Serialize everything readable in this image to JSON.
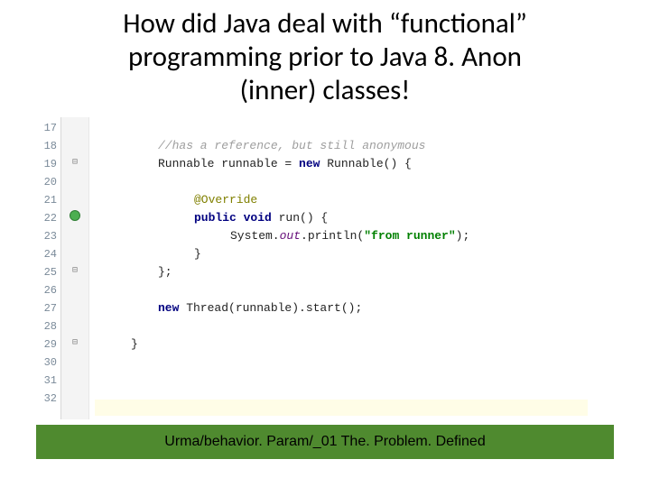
{
  "title_lines": {
    "l1": "How did Java deal with “functional”",
    "l2": "programming prior to Java 8. Anon",
    "l3": "(inner) classes!"
  },
  "line_numbers": [
    "17",
    "18",
    "19",
    "20",
    "21",
    "22",
    "23",
    "24",
    "25",
    "26",
    "27",
    "28",
    "29",
    "30",
    "31",
    "32"
  ],
  "code": {
    "l17": "",
    "l18_comment": "//has a reference, but still anonymous",
    "l19_a": "Runnable runnable = ",
    "l19_new": "new",
    "l19_b": " Runnable() {",
    "l20": "",
    "l21_ann": "@Override",
    "l22_kw": "public void",
    "l22_rest": " run() {",
    "l23_a": "System.",
    "l23_out": "out",
    "l23_b": ".println(",
    "l23_str": "\"from runner\"",
    "l23_c": ");",
    "l24": "}",
    "l25": "};",
    "l26": "",
    "l27_new": "new",
    "l27_rest": " Thread(runnable).start();",
    "l28": "",
    "l29": "}",
    "l30": "",
    "l31": ""
  },
  "footer": "Urma/behavior. Param/_01 The. Problem. Defined"
}
